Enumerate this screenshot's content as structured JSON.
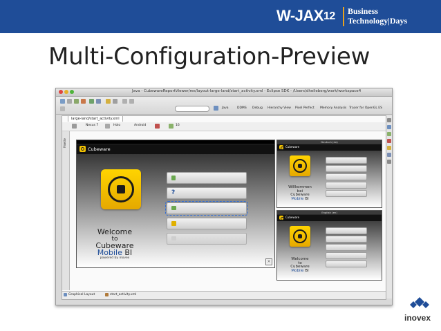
{
  "banner": {
    "brand_wjax": "W-JAX",
    "brand_number": "12",
    "tagline_line1": "Business",
    "tagline_line2": "Technology|Days",
    "background": "#1f4d98",
    "accent": "#e8a21c"
  },
  "slide": {
    "title": "Multi-Configuration-Preview"
  },
  "window": {
    "title": "Java - CubewareReportViewer/res/layout-large-land/start_activity.xml - Eclipse SDK - /Users/dheileberg/work/workspace4",
    "search_placeholder": "",
    "perspectives": [
      "Java",
      "DDMS",
      "Debug",
      "Hierarchy View",
      "Pixel Perfect",
      "Memory Analysis",
      "Tracer for OpenGL ES"
    ]
  },
  "editor": {
    "tab_label": "large-land/start_activity.xml",
    "toolbar": {
      "device_menu": "Nexus 7",
      "theme_menu": "Holo",
      "activity_menu": "Android",
      "locale_menu": "",
      "api_menu": "16"
    },
    "palette_label": "Palette",
    "bottom_tabs": [
      "Graphical Layout",
      "start_activity.xml"
    ]
  },
  "app": {
    "name": "Cubeware",
    "welcome_line1": "Welcome",
    "welcome_line2": "to",
    "welcome_line3": "Cubeware",
    "welcome_mobile": "Mobile",
    "welcome_bi": "BI",
    "powered_by": "powered by inovex",
    "small_welcome_line1": "Willkommen",
    "small_welcome_line2": "bei",
    "small_welcome_line3": "Cubeware"
  },
  "previews": [
    {
      "label": "Deutsch (de)"
    },
    {
      "label": "English (en)"
    }
  ],
  "footer": {
    "logo_text": "inovex"
  }
}
